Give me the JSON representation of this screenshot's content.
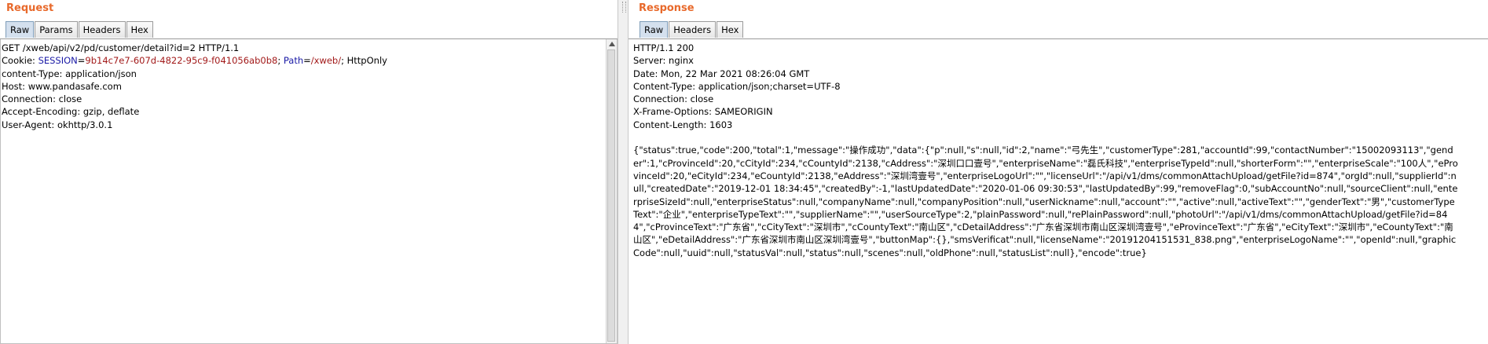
{
  "request": {
    "title": "Request",
    "tabs": [
      "Raw",
      "Params",
      "Headers",
      "Hex"
    ],
    "active_tab": "Raw",
    "lines": {
      "l1": "GET /xweb/api/v2/pd/customer/detail?id=2 HTTP/1.1",
      "cookie_name": "Cookie: ",
      "cookie_key1": "SESSION",
      "cookie_eq1": "=",
      "cookie_val1": "9b14c7e7-607d-4822-95c9-f041056ab0b8",
      "cookie_sep": "; ",
      "cookie_key2": "Path",
      "cookie_eq2": "=",
      "cookie_val2": "/xweb/",
      "cookie_tail": "; HttpOnly",
      "l3": "content-Type: application/json",
      "l4": "Host: www.pandasafe.com",
      "l5": "Connection: close",
      "l6": "Accept-Encoding: gzip, deflate",
      "l7": "User-Agent: okhttp/3.0.1"
    }
  },
  "response": {
    "title": "Response",
    "tabs": [
      "Raw",
      "Headers",
      "Hex"
    ],
    "active_tab": "Raw",
    "headers": [
      "HTTP/1.1 200",
      "Server: nginx",
      "Date: Mon, 22 Mar 2021 08:26:04 GMT",
      "Content-Type: application/json;charset=UTF-8",
      "Connection: close",
      "X-Frame-Options: SAMEORIGIN",
      "Content-Length: 1603"
    ],
    "body": "{\"status\":true,\"code\":200,\"total\":1,\"message\":\"操作成功\",\"data\":{\"p\":null,\"s\":null,\"id\":2,\"name\":\"弓先生\",\"customerType\":281,\"accountId\":99,\"contactNumber\":\"15002093113\",\"gender\":1,\"cProvinceId\":20,\"cCityId\":234,\"cCountyId\":2138,\"cAddress\":\"深圳口口壹号\",\"enterpriseName\":\"磊氏科技\",\"enterpriseTypeId\":null,\"shorterForm\":\"\",\"enterpriseScale\":\"100人\",\"eProvinceId\":20,\"eCityId\":234,\"eCountyId\":2138,\"eAddress\":\"深圳湾壹号\",\"enterpriseLogoUrl\":\"\",\"licenseUrl\":\"/api/v1/dms/commonAttachUpload/getFile?id=874\",\"orgId\":null,\"supplierId\":null,\"createdDate\":\"2019-12-01 18:34:45\",\"createdBy\":-1,\"lastUpdatedDate\":\"2020-01-06 09:30:53\",\"lastUpdatedBy\":99,\"removeFlag\":0,\"subAccountNo\":null,\"sourceClient\":null,\"enterpriseSizeId\":null,\"enterpriseStatus\":null,\"companyName\":null,\"companyPosition\":null,\"userNickname\":null,\"account\":\"\",\"active\":null,\"activeText\":\"\",\"genderText\":\"男\",\"customerTypeText\":\"企业\",\"enterpriseTypeText\":\"\",\"supplierName\":\"\",\"userSourceType\":2,\"plainPassword\":null,\"rePlainPassword\":null,\"photoUrl\":\"/api/v1/dms/commonAttachUpload/getFile?id=844\",\"cProvinceText\":\"广东省\",\"cCityText\":\"深圳市\",\"cCountyText\":\"南山区\",\"cDetailAddress\":\"广东省深圳市南山区深圳湾壹号\",\"eProvinceText\":\"广东省\",\"eCityText\":\"深圳市\",\"eCountyText\":\"南山区\",\"eDetailAddress\":\"广东省深圳市南山区深圳湾壹号\",\"buttonMap\":{},\"smsVerificat\":null,\"licenseName\":\"20191204151531_838.png\",\"enterpriseLogoName\":\"\",\"openId\":null,\"graphicCode\":null,\"uuid\":null,\"statusVal\":null,\"status\":null,\"scenes\":null,\"oldPhone\":null,\"statusList\":null},\"encode\":true}"
  },
  "colors": {
    "title": "#e8692b",
    "active_tab": "#d4e0ee",
    "cookie_key": "#1a1aa6",
    "cookie_value": "#a21a1a"
  }
}
